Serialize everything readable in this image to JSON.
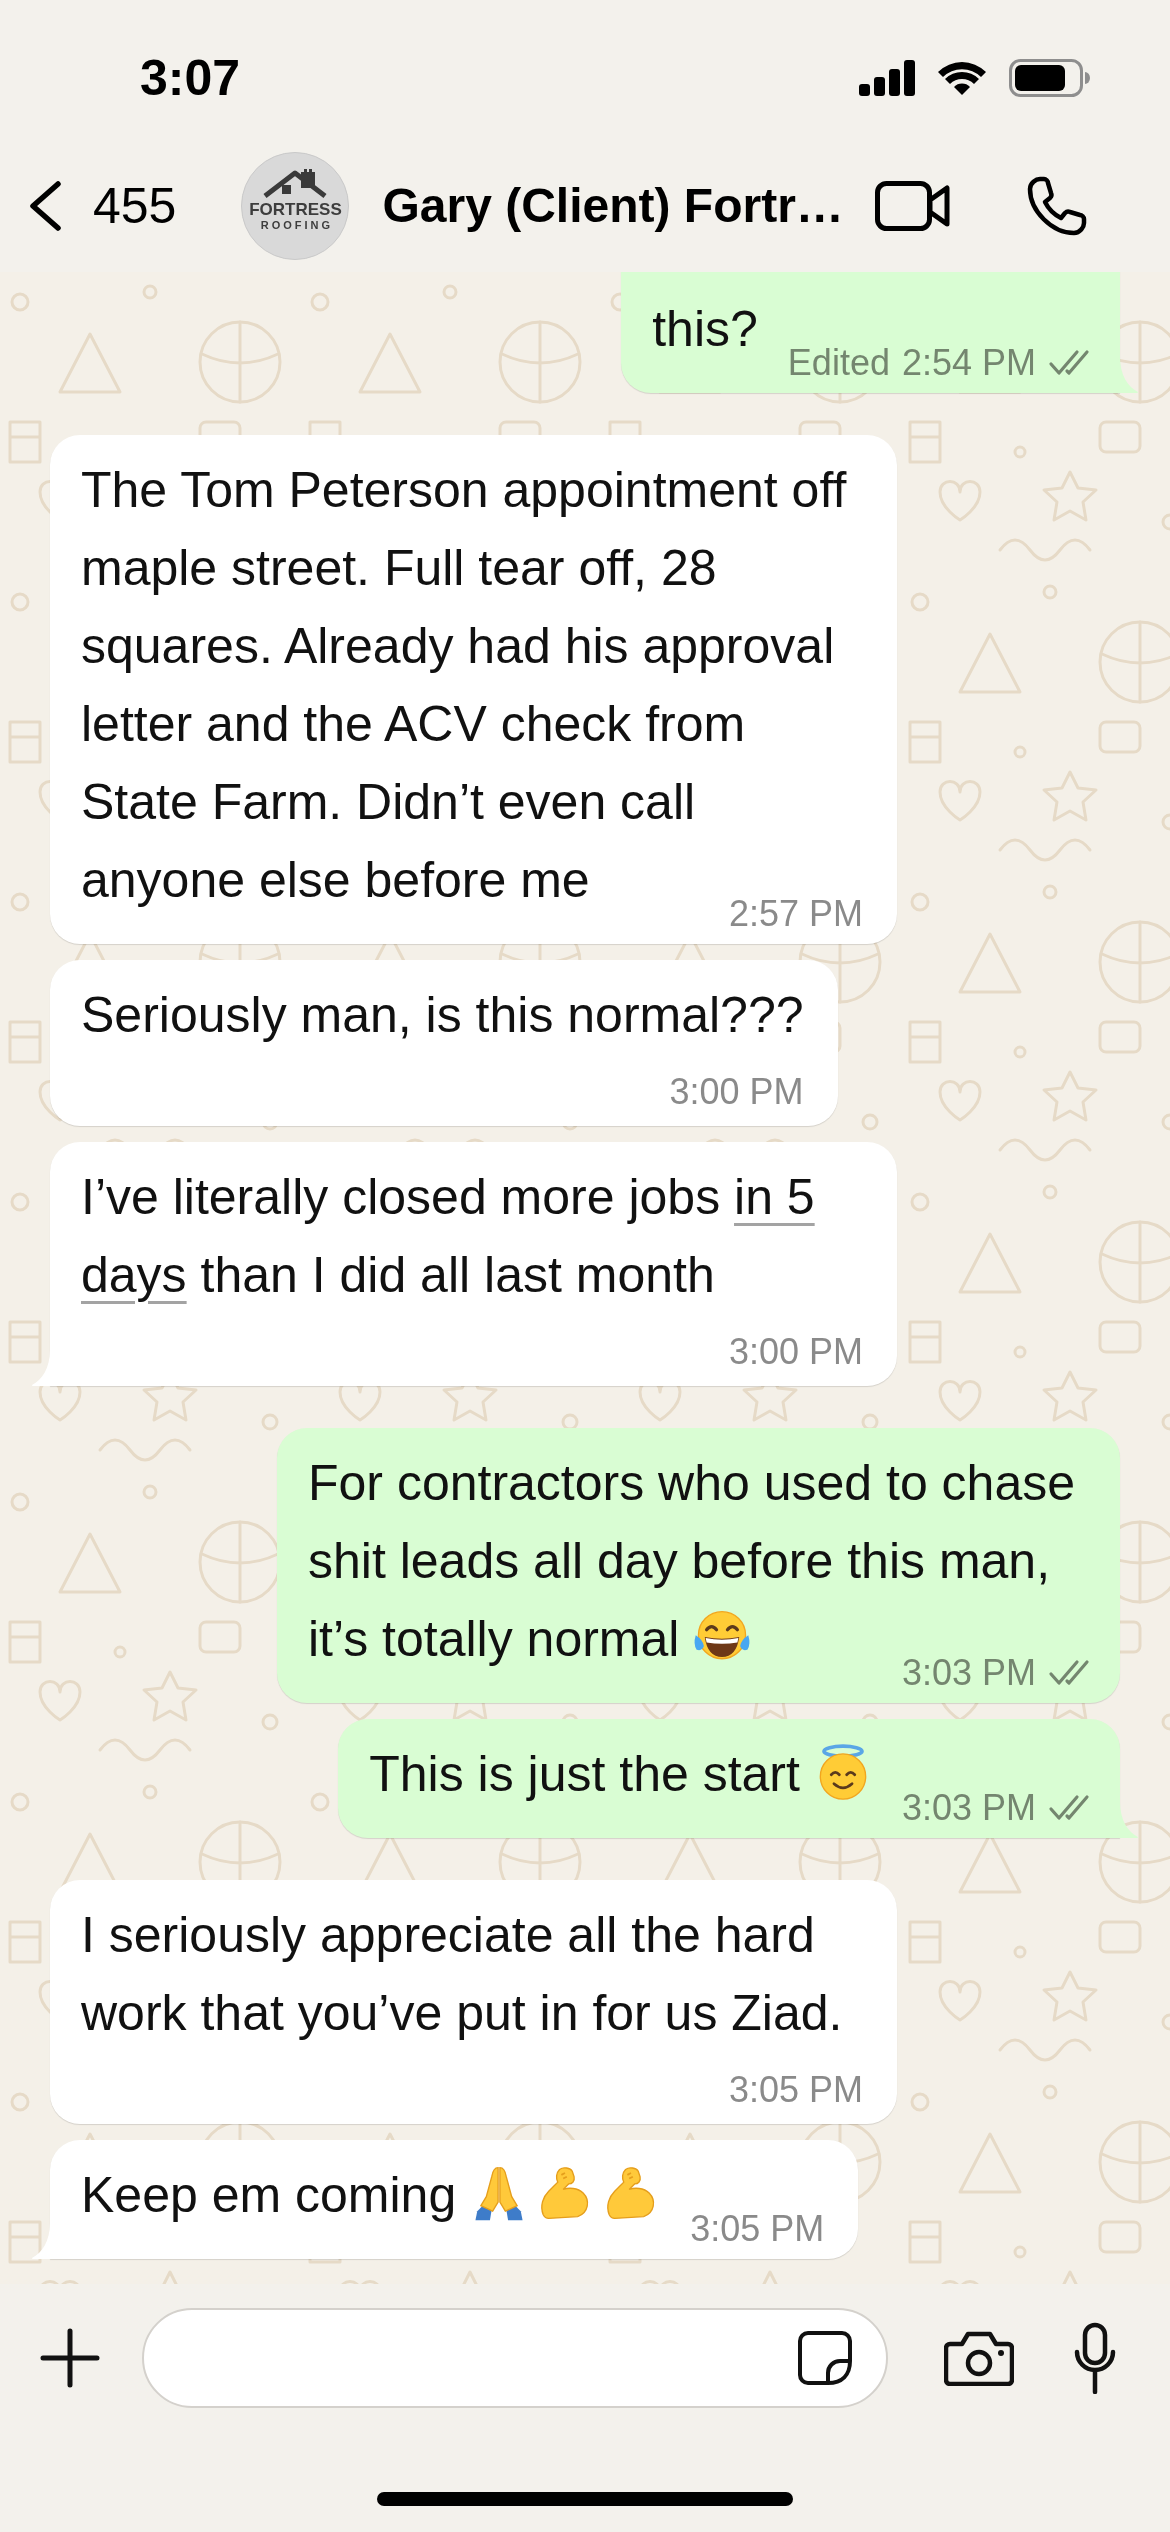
{
  "status_bar": {
    "time": "3:07"
  },
  "header": {
    "back_count": "455",
    "avatar_logo": [
      "FORTRESS",
      "ROOFING"
    ],
    "title": "Gary (Client) Fortr…"
  },
  "messages": [
    {
      "kind": "outgoing",
      "continues_above": true,
      "text": "this?",
      "edited_label": "Edited",
      "time": "2:54 PM",
      "read": false,
      "tail": true
    },
    {
      "kind": "incoming",
      "text": "The Tom Peterson appointment off maple street. Full tear off, 28 squares. Already had his approval letter and the ACV check from State Farm. Didn’t even call anyone else before me",
      "time": "2:57 PM",
      "tail": false
    },
    {
      "kind": "incoming",
      "text": "Seriously man, is this normal???",
      "time": "3:00 PM",
      "tail": false
    },
    {
      "kind": "incoming",
      "segments": [
        {
          "text": "I’ve literally closed more jobs ",
          "underline": false
        },
        {
          "text": "in 5 days",
          "underline": true
        },
        {
          "text": " than I did all last month",
          "underline": false
        }
      ],
      "time": "3:00 PM",
      "tail": true
    },
    {
      "kind": "outgoing",
      "text": "For contractors who used to chase shit leads all day before this man, it’s totally normal",
      "emojis": [
        {
          "kind": "tears_of_joy"
        }
      ],
      "time": "3:03 PM",
      "read": false,
      "tail": false
    },
    {
      "kind": "outgoing",
      "text": "This is just the start",
      "emojis": [
        {
          "kind": "smiling_halo"
        }
      ],
      "time": "3:03 PM",
      "read": false,
      "tail": true
    },
    {
      "kind": "incoming",
      "text": "I seriously appreciate all the hard work that you’ve put in for us Ziad.",
      "time": "3:05 PM",
      "tail": false
    },
    {
      "kind": "incoming",
      "text": "Keep em coming",
      "emojis": [
        {
          "kind": "folded_hands"
        },
        {
          "kind": "flexed_biceps"
        },
        {
          "kind": "flexed_biceps"
        }
      ],
      "time": "3:05 PM",
      "tail": true
    }
  ]
}
